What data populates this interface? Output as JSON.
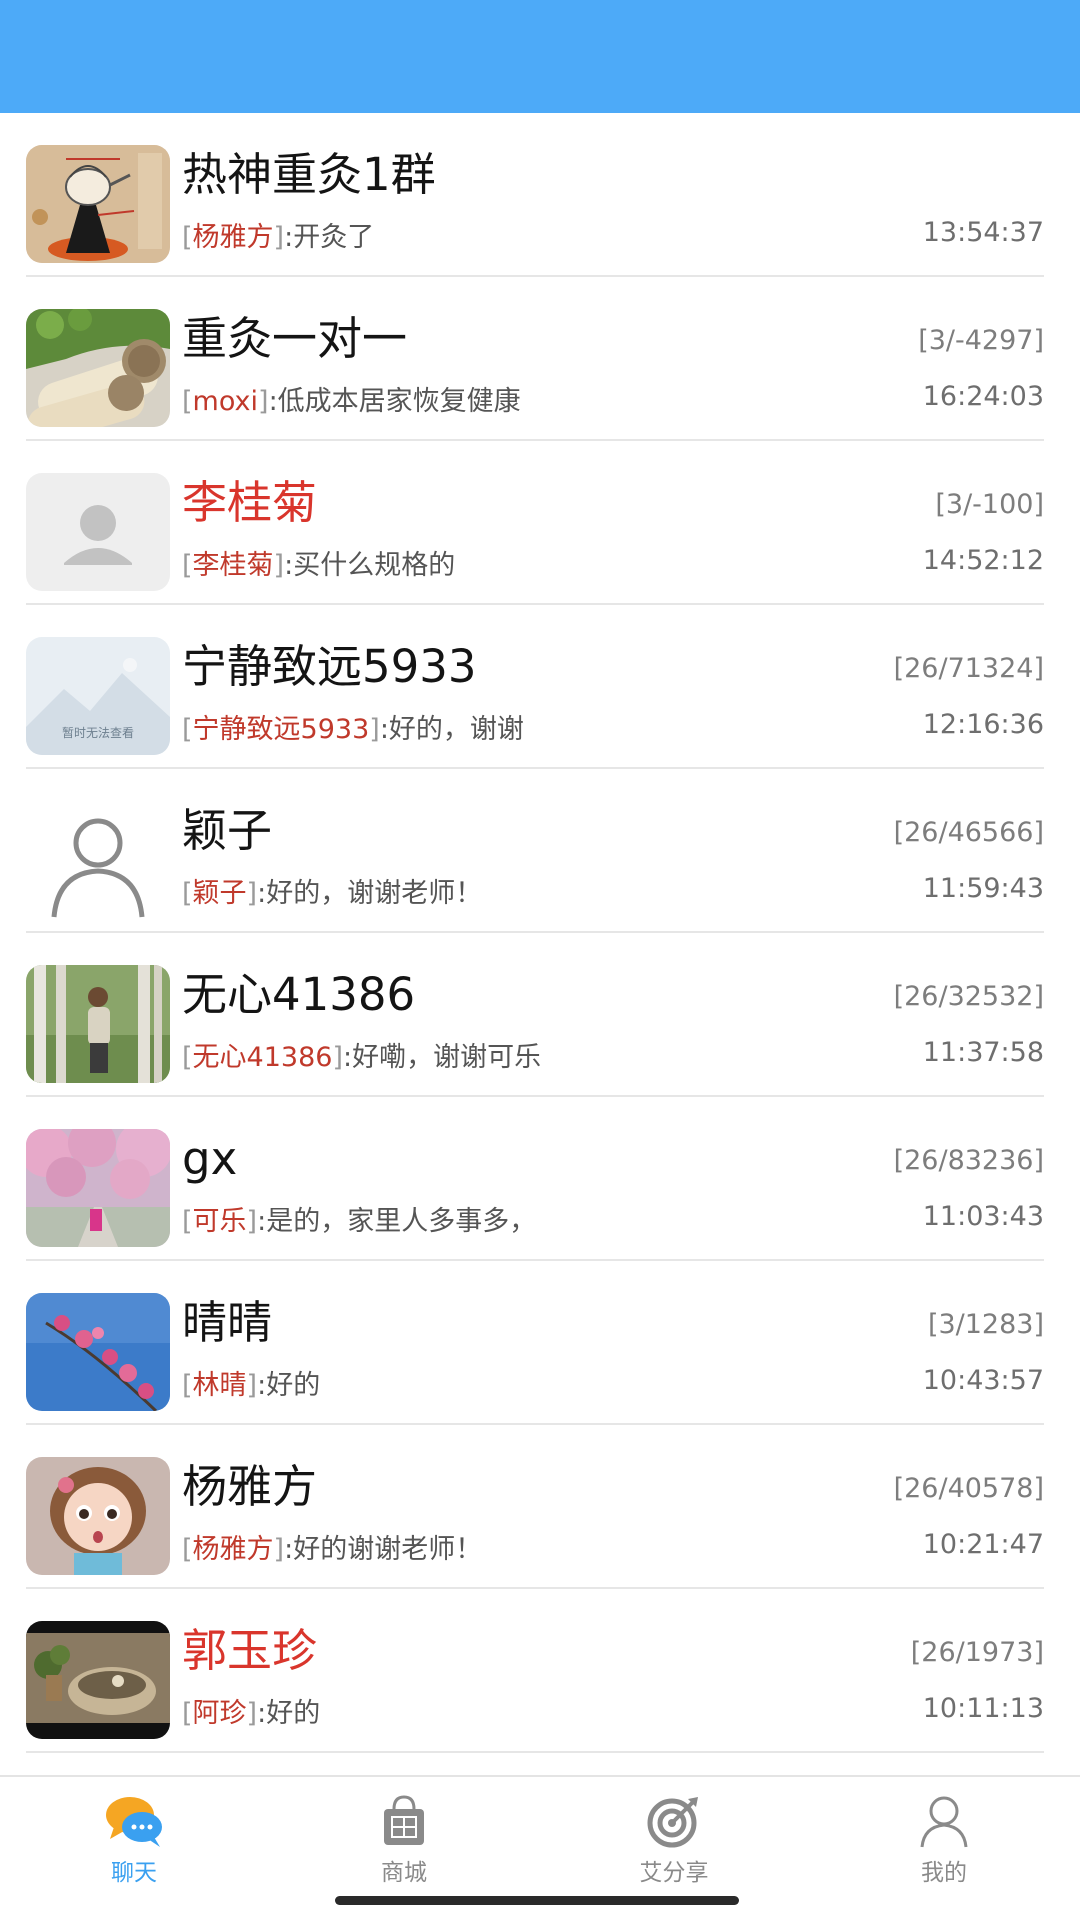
{
  "chats": [
    {
      "name": "热神重灸1群",
      "name_red": false,
      "sender": "杨雅方",
      "text": ":开灸了",
      "count": "",
      "time": "13:54:37",
      "avatar": "teapot-diagram"
    },
    {
      "name": "重灸一对一",
      "name_red": false,
      "sender": "moxi",
      "text": ":低成本居家恢复健康",
      "count": "[3/-4297]",
      "time": "16:24:03",
      "avatar": "moxa-rolls"
    },
    {
      "name": "李桂菊",
      "name_red": true,
      "sender": "李桂菊",
      "text": ":买什么规格的",
      "count": "[3/-100]",
      "time": "14:52:12",
      "avatar": "default-person"
    },
    {
      "name": "宁静致远5933",
      "name_red": false,
      "sender": "宁静致远5933",
      "text": ":好的，谢谢",
      "count": "[26/71324]",
      "time": "12:16:36",
      "avatar": "image-unavailable"
    },
    {
      "name": "颖子",
      "name_red": false,
      "sender": "颖子",
      "text": ":好的，谢谢老师！",
      "count": "[26/46566]",
      "time": "11:59:43",
      "avatar": "outline-person"
    },
    {
      "name": "无心41386",
      "name_red": false,
      "sender": "无心41386",
      "text": ":好嘞，谢谢可乐",
      "count": "[26/32532]",
      "time": "11:37:58",
      "avatar": "woman-in-birch-forest"
    },
    {
      "name": "gx",
      "name_red": false,
      "sender": "可乐",
      "text": ":是的，家里人多事多，",
      "count": "[26/83236]",
      "time": "11:03:43",
      "avatar": "cherry-blossom-path"
    },
    {
      "name": "晴晴",
      "name_red": false,
      "sender": "林晴",
      "text": ":好的",
      "count": "[3/1283]",
      "time": "10:43:57",
      "avatar": "pink-blossom-sky"
    },
    {
      "name": "杨雅方",
      "name_red": false,
      "sender": "杨雅方",
      "text": ":好的谢谢老师！",
      "count": "[26/40578]",
      "time": "10:21:47",
      "avatar": "cartoon-girl"
    },
    {
      "name": "郭玉珍",
      "name_red": true,
      "sender": "阿珍",
      "text": ":好的",
      "count": "[26/1973]",
      "time": "10:11:13",
      "avatar": "plant-in-bowl"
    }
  ],
  "avatar_placeholder_text": "暂时无法查看",
  "tabs": [
    {
      "label": "聊天",
      "icon": "chat-bubbles-icon",
      "active": true
    },
    {
      "label": "商城",
      "icon": "shopping-bag-icon",
      "active": false
    },
    {
      "label": "艾分享",
      "icon": "target-icon",
      "active": false
    },
    {
      "label": "我的",
      "icon": "user-icon",
      "active": false
    }
  ],
  "colors": {
    "header": "#4daaf8",
    "active_tab": "#3aa0f0",
    "sender": "#c0392b",
    "name_highlight": "#d9352c"
  }
}
